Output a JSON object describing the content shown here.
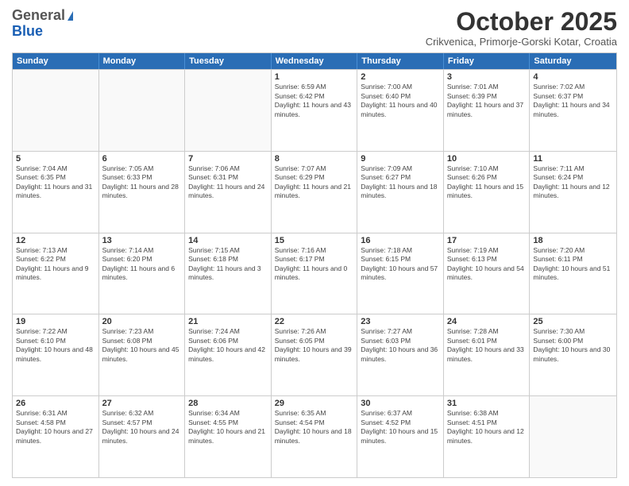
{
  "header": {
    "logo_general": "General",
    "logo_blue": "Blue",
    "title": "October 2025",
    "subtitle": "Crikvenica, Primorje-Gorski Kotar, Croatia"
  },
  "days_of_week": [
    "Sunday",
    "Monday",
    "Tuesday",
    "Wednesday",
    "Thursday",
    "Friday",
    "Saturday"
  ],
  "weeks": [
    [
      {
        "day": "",
        "empty": true
      },
      {
        "day": "",
        "empty": true
      },
      {
        "day": "",
        "empty": true
      },
      {
        "day": "1",
        "sunrise": "6:59 AM",
        "sunset": "6:42 PM",
        "daylight": "11 hours and 43 minutes."
      },
      {
        "day": "2",
        "sunrise": "7:00 AM",
        "sunset": "6:40 PM",
        "daylight": "11 hours and 40 minutes."
      },
      {
        "day": "3",
        "sunrise": "7:01 AM",
        "sunset": "6:39 PM",
        "daylight": "11 hours and 37 minutes."
      },
      {
        "day": "4",
        "sunrise": "7:02 AM",
        "sunset": "6:37 PM",
        "daylight": "11 hours and 34 minutes."
      }
    ],
    [
      {
        "day": "5",
        "sunrise": "7:04 AM",
        "sunset": "6:35 PM",
        "daylight": "11 hours and 31 minutes."
      },
      {
        "day": "6",
        "sunrise": "7:05 AM",
        "sunset": "6:33 PM",
        "daylight": "11 hours and 28 minutes."
      },
      {
        "day": "7",
        "sunrise": "7:06 AM",
        "sunset": "6:31 PM",
        "daylight": "11 hours and 24 minutes."
      },
      {
        "day": "8",
        "sunrise": "7:07 AM",
        "sunset": "6:29 PM",
        "daylight": "11 hours and 21 minutes."
      },
      {
        "day": "9",
        "sunrise": "7:09 AM",
        "sunset": "6:27 PM",
        "daylight": "11 hours and 18 minutes."
      },
      {
        "day": "10",
        "sunrise": "7:10 AM",
        "sunset": "6:26 PM",
        "daylight": "11 hours and 15 minutes."
      },
      {
        "day": "11",
        "sunrise": "7:11 AM",
        "sunset": "6:24 PM",
        "daylight": "11 hours and 12 minutes."
      }
    ],
    [
      {
        "day": "12",
        "sunrise": "7:13 AM",
        "sunset": "6:22 PM",
        "daylight": "11 hours and 9 minutes."
      },
      {
        "day": "13",
        "sunrise": "7:14 AM",
        "sunset": "6:20 PM",
        "daylight": "11 hours and 6 minutes."
      },
      {
        "day": "14",
        "sunrise": "7:15 AM",
        "sunset": "6:18 PM",
        "daylight": "11 hours and 3 minutes."
      },
      {
        "day": "15",
        "sunrise": "7:16 AM",
        "sunset": "6:17 PM",
        "daylight": "11 hours and 0 minutes."
      },
      {
        "day": "16",
        "sunrise": "7:18 AM",
        "sunset": "6:15 PM",
        "daylight": "10 hours and 57 minutes."
      },
      {
        "day": "17",
        "sunrise": "7:19 AM",
        "sunset": "6:13 PM",
        "daylight": "10 hours and 54 minutes."
      },
      {
        "day": "18",
        "sunrise": "7:20 AM",
        "sunset": "6:11 PM",
        "daylight": "10 hours and 51 minutes."
      }
    ],
    [
      {
        "day": "19",
        "sunrise": "7:22 AM",
        "sunset": "6:10 PM",
        "daylight": "10 hours and 48 minutes."
      },
      {
        "day": "20",
        "sunrise": "7:23 AM",
        "sunset": "6:08 PM",
        "daylight": "10 hours and 45 minutes."
      },
      {
        "day": "21",
        "sunrise": "7:24 AM",
        "sunset": "6:06 PM",
        "daylight": "10 hours and 42 minutes."
      },
      {
        "day": "22",
        "sunrise": "7:26 AM",
        "sunset": "6:05 PM",
        "daylight": "10 hours and 39 minutes."
      },
      {
        "day": "23",
        "sunrise": "7:27 AM",
        "sunset": "6:03 PM",
        "daylight": "10 hours and 36 minutes."
      },
      {
        "day": "24",
        "sunrise": "7:28 AM",
        "sunset": "6:01 PM",
        "daylight": "10 hours and 33 minutes."
      },
      {
        "day": "25",
        "sunrise": "7:30 AM",
        "sunset": "6:00 PM",
        "daylight": "10 hours and 30 minutes."
      }
    ],
    [
      {
        "day": "26",
        "sunrise": "6:31 AM",
        "sunset": "4:58 PM",
        "daylight": "10 hours and 27 minutes."
      },
      {
        "day": "27",
        "sunrise": "6:32 AM",
        "sunset": "4:57 PM",
        "daylight": "10 hours and 24 minutes."
      },
      {
        "day": "28",
        "sunrise": "6:34 AM",
        "sunset": "4:55 PM",
        "daylight": "10 hours and 21 minutes."
      },
      {
        "day": "29",
        "sunrise": "6:35 AM",
        "sunset": "4:54 PM",
        "daylight": "10 hours and 18 minutes."
      },
      {
        "day": "30",
        "sunrise": "6:37 AM",
        "sunset": "4:52 PM",
        "daylight": "10 hours and 15 minutes."
      },
      {
        "day": "31",
        "sunrise": "6:38 AM",
        "sunset": "4:51 PM",
        "daylight": "10 hours and 12 minutes."
      },
      {
        "day": "",
        "empty": true
      }
    ]
  ]
}
